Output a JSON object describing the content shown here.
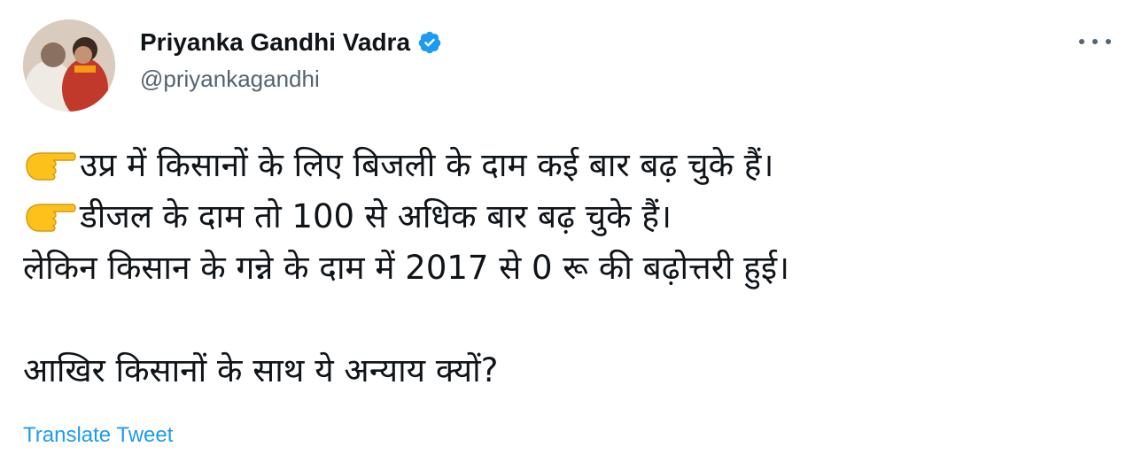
{
  "author": {
    "display_name": "Priyanka Gandhi Vadra",
    "handle": "@priyankagandhi",
    "verified": true,
    "avatar_icon": "profile-photo",
    "verified_icon": "verified-badge-icon"
  },
  "menu": {
    "icon": "more-options-icon"
  },
  "tweet": {
    "lines": [
      "उप्र में किसानों के लिए बिजली के दाम कई बार बढ़ चुके हैं।",
      "डीजल के दाम तो 100 से अधिक बार बढ़ चुके हैं।",
      "लेकिन किसान के गन्ने के दाम में 2017 से 0 रू की बढ़ोत्तरी हुई।",
      "आखिर किसानों के साथ ये अन्याय क्यों?"
    ],
    "pointer_icon": "backhand-index-pointing-right-emoji"
  },
  "translate_label": "Translate Tweet",
  "colors": {
    "text": "#0f1419",
    "secondary": "#536471",
    "link": "#1d9bf0",
    "verified": "#1d9bf0"
  }
}
